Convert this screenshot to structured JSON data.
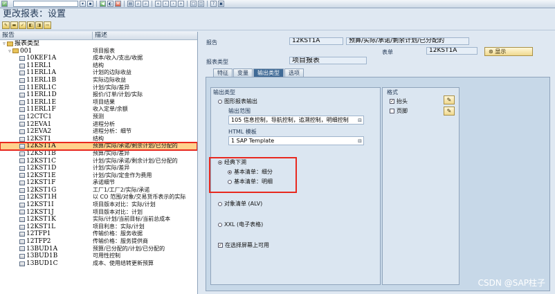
{
  "system_toolbar": {
    "icons": [
      "enter-icon",
      "save-icon",
      "back-icon",
      "exit-icon",
      "cancel-icon",
      "print-icon",
      "find-icon",
      "find-next-icon",
      "first-page-icon",
      "prev-page-icon",
      "next-page-icon",
      "last-page-icon",
      "create-session-icon",
      "shortcut-icon",
      "help-icon",
      "customize-icon"
    ]
  },
  "title": "更改报表：设置",
  "tree": {
    "header_col1": "报告",
    "header_col2": "描述",
    "rows": [
      {
        "id": "报表类型",
        "desc": "",
        "kind": "folder",
        "expanded": true,
        "indent": 1
      },
      {
        "id": "001",
        "desc": "项目报表",
        "kind": "folder",
        "expanded": true,
        "indent": 2
      },
      {
        "id": "10KEF1A",
        "desc": "成本/收入/支出/收据",
        "indent": 3
      },
      {
        "id": "11ERL1",
        "desc": "结构",
        "indent": 3
      },
      {
        "id": "11ERL1A",
        "desc": "计划的边际收益",
        "indent": 3
      },
      {
        "id": "11ERL1B",
        "desc": "实际边际收益",
        "indent": 3
      },
      {
        "id": "11ERL1C",
        "desc": "计划/实际/差异",
        "indent": 3
      },
      {
        "id": "11ERL1D",
        "desc": "报价/订单/计划/实际",
        "indent": 3
      },
      {
        "id": "11ERL1E",
        "desc": "项目结果",
        "indent": 3
      },
      {
        "id": "11ERL1F",
        "desc": "收入定单/余额",
        "indent": 3
      },
      {
        "id": "12CTC1",
        "desc": "预测",
        "indent": 3
      },
      {
        "id": "12EVA1",
        "desc": "进程分析",
        "indent": 3
      },
      {
        "id": "12EVA2",
        "desc": "进程分析：细节",
        "indent": 3
      },
      {
        "id": "12KST1",
        "desc": "结构",
        "indent": 3
      },
      {
        "id": "12KST1A",
        "desc": "预算/实际/承诺/剩余计划/已分配的",
        "indent": 3,
        "selected": true
      },
      {
        "id": "12KST1B",
        "desc": "预算/实际/差异",
        "indent": 3
      },
      {
        "id": "12KST1C",
        "desc": "计划/实际/承诺/剩余计划/已分配的",
        "indent": 3
      },
      {
        "id": "12KST1D",
        "desc": "计划/实际/差异",
        "indent": 3
      },
      {
        "id": "12KST1E",
        "desc": "计划/实际/定金作为费用",
        "indent": 3
      },
      {
        "id": "12KST1F",
        "desc": "承诺细节",
        "indent": 3
      },
      {
        "id": "12KST1G",
        "desc": "工厂1/工厂2/实际/承诺",
        "indent": 3
      },
      {
        "id": "12KST1H",
        "desc": "以 CO 范围/对象/交易货币表示的实际",
        "indent": 3
      },
      {
        "id": "12KST1I",
        "desc": "项目版本对比：实际/计划",
        "indent": 3
      },
      {
        "id": "12KST1J",
        "desc": "项目版本对比：计划",
        "indent": 3
      },
      {
        "id": "12KST1K",
        "desc": "实际/计划/当前目标/当前总成本",
        "indent": 3
      },
      {
        "id": "12KST1L",
        "desc": "项目利息：实际/计划",
        "indent": 3
      },
      {
        "id": "12TFP1",
        "desc": "传输价格：服务收据",
        "indent": 3
      },
      {
        "id": "12TFP2",
        "desc": "传输价格：服务提供商",
        "indent": 3
      },
      {
        "id": "13BUD1A",
        "desc": "预算/已分配的/计划/已分配的",
        "indent": 3
      },
      {
        "id": "13BUD1B",
        "desc": "可用性控制",
        "indent": 3
      },
      {
        "id": "13BUD1C",
        "desc": "成本、使用结转更新预算",
        "indent": 3
      }
    ]
  },
  "header_fields": {
    "report_label": "报告",
    "report_value": "12KST1A",
    "report_desc": "预算/实际/承诺/剩余计划/已分配的",
    "form_label": "表单",
    "form_value": "12KST1A",
    "display_button": "显示",
    "report_type_label": "报表类型",
    "report_type_value": "项目报表"
  },
  "tabs": [
    {
      "label": "特征",
      "active": false
    },
    {
      "label": "变量",
      "active": false
    },
    {
      "label": "输出类型",
      "active": true
    },
    {
      "label": "选项",
      "active": false
    }
  ],
  "output_type": {
    "group_title": "输出类型",
    "graphical_label": "图形报表输出",
    "output_scope_label": "输出范围",
    "output_scope_value": "105 信息控制，导航控制，追溯控制，明细控制",
    "html_template_label": "HTML 模板",
    "html_template_value": "1 SAP Template",
    "classic_drilldown": "经典下溯",
    "basic_list_breakdown": "基本清单：细分",
    "basic_list_detail": "基本清单：明细",
    "object_list": "对象清单 (ALV)",
    "xxl": "XXL (电子表格)",
    "fullscreen": "在选择屏幕上可用",
    "selected": "classic_drilldown",
    "sub_selected": "breakdown",
    "fullscreen_checked": true
  },
  "format": {
    "group_title": "格式",
    "header_label": "抬头",
    "header_checked": true,
    "footer_label": "页脚",
    "footer_checked": false
  },
  "watermark": "CSDN @SAP柱子",
  "colors": {
    "highlight_border": "#e8281e",
    "selection_fill": "#ffd18c",
    "active_tab": "#3f6a96"
  }
}
